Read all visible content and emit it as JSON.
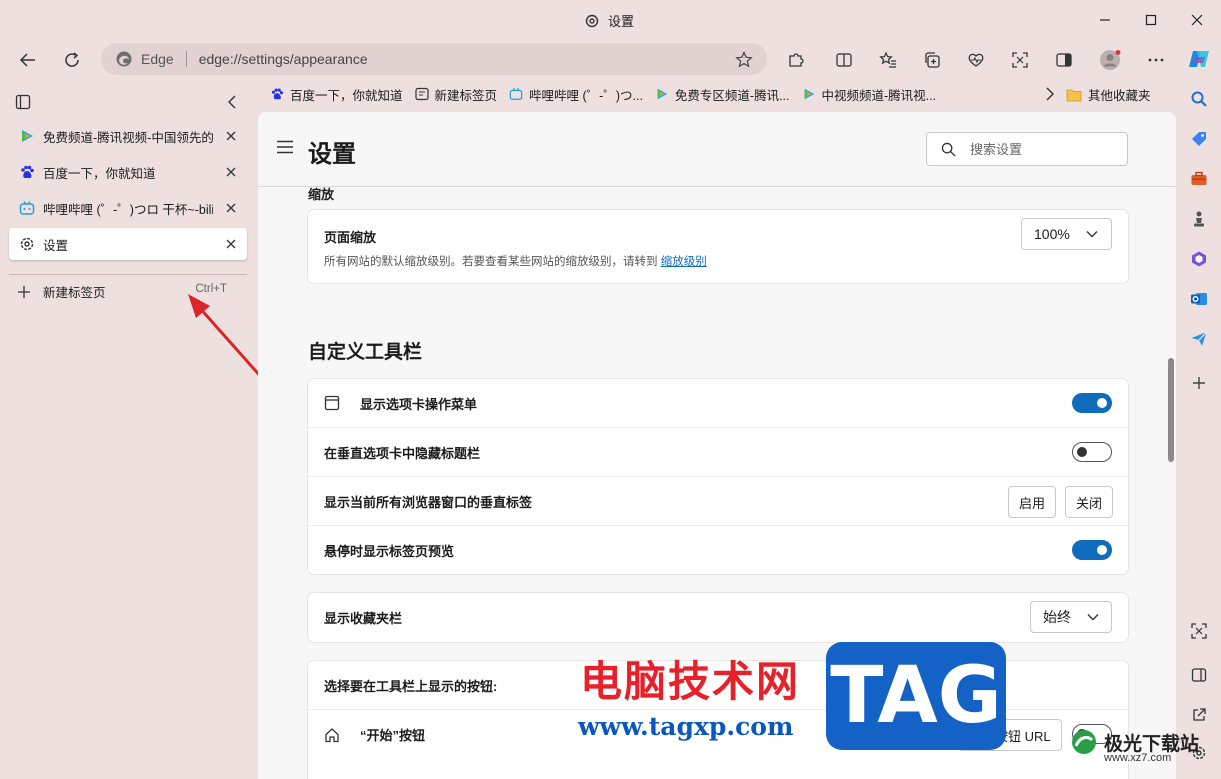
{
  "window": {
    "title": "设置"
  },
  "address": {
    "host": "Edge",
    "url": "edge://settings/appearance"
  },
  "tabs": [
    {
      "label": "免费频道-腾讯视频-中国领先的在",
      "icon": "tencent-video-icon"
    },
    {
      "label": "百度一下，你就知道",
      "icon": "baidu-icon"
    },
    {
      "label": "哔哩哔哩 (゜-゜)つロ 干杯~-bilibili",
      "icon": "bilibili-icon"
    },
    {
      "label": "设置",
      "icon": "gear-icon",
      "active": true
    }
  ],
  "new_tab": {
    "label": "新建标签页",
    "shortcut": "Ctrl+T"
  },
  "favorites": [
    {
      "label": "百度一下，你就知道",
      "icon": "baidu-icon"
    },
    {
      "label": "新建标签页",
      "icon": "newtab-icon"
    },
    {
      "label": "哔哩哔哩 (゜-゜)つ...",
      "icon": "bilibili-icon"
    },
    {
      "label": "免费专区频道-腾讯...",
      "icon": "tencent-video-icon"
    },
    {
      "label": "中视频频道-腾讯视...",
      "icon": "tencent-video-icon"
    }
  ],
  "favorites_other": "其他收藏夹",
  "settings": {
    "title": "设置",
    "search_placeholder": "搜索设置",
    "zoom_section_cut": "缩放",
    "zoom": {
      "label": "页面缩放",
      "description": "所有网站的默认缩放级别。若要查看某些网站的缩放级别，请转到",
      "link": "缩放级别",
      "value": "100%"
    },
    "toolbar_heading": "自定义工具栏",
    "toolbar_rows": {
      "tab_actions_menu": {
        "label": "显示选项卡操作菜单",
        "on": true
      },
      "hide_title_bar": {
        "label": "在垂直选项卡中隐藏标题栏",
        "on": false
      },
      "vertical_tabs_all": {
        "label": "显示当前所有浏览器窗口的垂直标签",
        "enable": "启用",
        "disable": "关闭"
      },
      "hover_preview": {
        "label": "悬停时显示标签页预览",
        "on": true
      }
    },
    "favbar_row": {
      "label": "显示收藏夹栏",
      "value": "始终"
    },
    "buttons_heading": "选择要在工具栏上显示的按钮:",
    "home_button": {
      "label": "“开始”按钮",
      "action": "设置按钮 URL"
    }
  },
  "watermark": {
    "cn_text": "电脑技术网",
    "url_text": "www.tagxp.com",
    "tag": "TAG",
    "site_name": "极光下载站",
    "site_url": "www.xz7.com"
  },
  "colors": {
    "chrome_bg": "#eee0df",
    "accent": "#0f6cbd",
    "content_bg": "#f7f7f7"
  }
}
